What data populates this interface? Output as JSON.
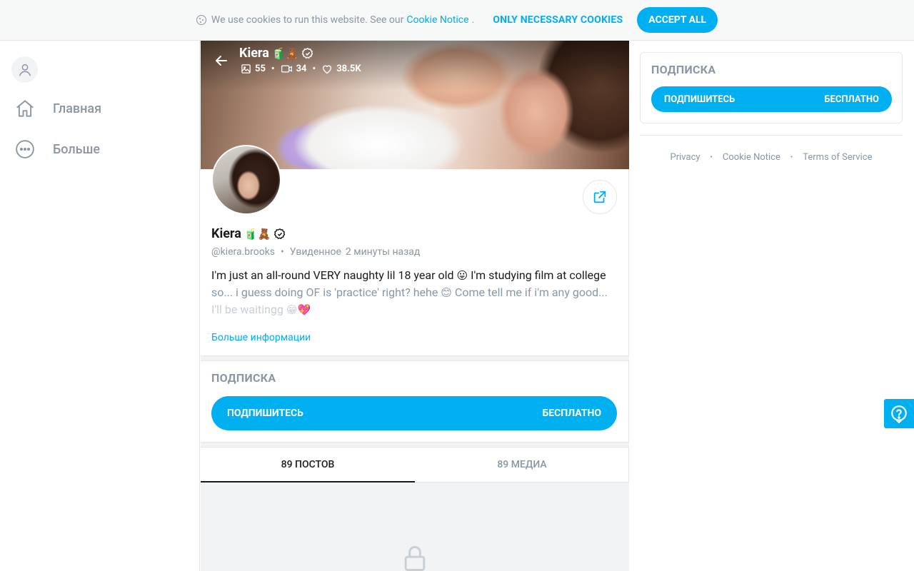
{
  "cookie": {
    "text": "We use cookies to run this website. See our",
    "link": "Cookie Notice",
    "dot": ".",
    "necessary": "ONLY NECESSARY COOKIES",
    "accept": "ACCEPT ALL"
  },
  "sidebar": {
    "items": [
      {
        "label": "Главная",
        "icon": "home-icon"
      },
      {
        "label": "Больше",
        "icon": "more-icon"
      }
    ]
  },
  "cover": {
    "name": "Kiera",
    "badges": "🧃🧸",
    "stats": {
      "photos": "55",
      "videos": "34",
      "likes": "38.5K"
    },
    "stat_sep": "•"
  },
  "profile": {
    "name": "Kiera",
    "badges": "🧃🧸",
    "handle": "@kiera.brooks",
    "seen_label": "Увиденное",
    "seen_time": "2 минуты назад",
    "dot": "•",
    "bio_line1": "I'm just an all-round VERY naughty lil 18 year old",
    "bio_emoji1": "😛",
    "bio_line1b": "I'm studying film at college",
    "bio_line2": "so... i guess doing OF is 'practice' right? hehe",
    "bio_emoji2": "😊",
    "bio_line2b": "Come tell me if i'm any good...",
    "bio_line3": "I'll be waitingg",
    "bio_emoji3": "😁💖",
    "more_info": "Больше информации"
  },
  "subscription": {
    "title": "ПОДПИСКА",
    "button_label": "ПОДПИШИТЕСЬ",
    "button_price": "БЕСПЛАТНО"
  },
  "tabs": [
    {
      "label": "89 ПОСТОВ",
      "active": true
    },
    {
      "label": "89 МЕДИА",
      "active": false
    }
  ],
  "right": {
    "title": "ПОДПИСКА",
    "button_label": "ПОДПИШИТЕСЬ",
    "button_price": "БЕСПЛАТНО",
    "footer": [
      "Privacy",
      "Cookie Notice",
      "Terms of Service"
    ],
    "footer_sep": "•"
  },
  "colors": {
    "accent": "#00aff0",
    "muted": "#8a96a3",
    "text": "#1a1a1a"
  }
}
